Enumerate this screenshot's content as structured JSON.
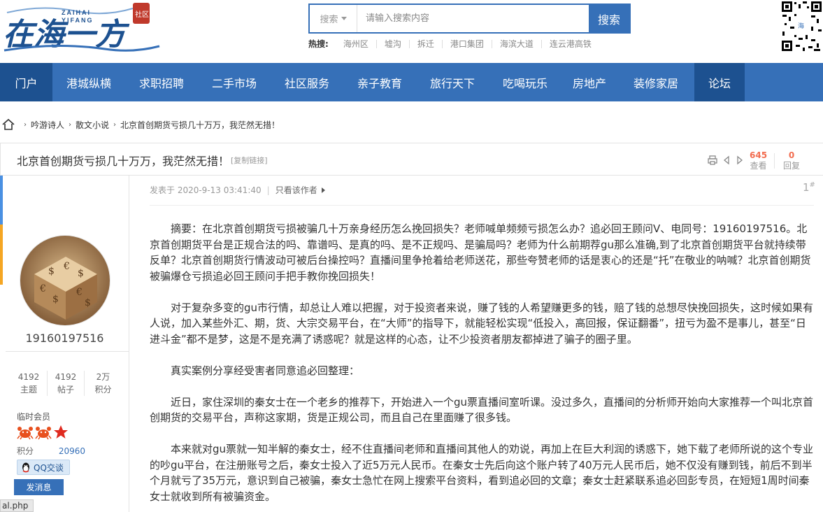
{
  "header": {
    "logo": {
      "main": "在海一方",
      "sub1": "ZAIHAI",
      "sub2": "YIFANG",
      "seal": "社区"
    },
    "search": {
      "type_label": "搜索",
      "placeholder": "请输入搜索内容",
      "button_label": "搜索"
    },
    "hot": {
      "label": "热搜:",
      "items": [
        "海州区",
        "墟沟",
        "拆迁",
        "港口集团",
        "海滨大道",
        "连云港高铁"
      ]
    }
  },
  "nav": {
    "items": [
      "门户",
      "港城纵横",
      "求职招聘",
      "二手市场",
      "社区服务",
      "亲子教育",
      "旅行天下",
      "吃喝玩乐",
      "房地产",
      "装修家居",
      "论坛"
    ]
  },
  "breadcrumb": {
    "items": [
      "吟游诗人",
      "散文小说",
      "北京首创期货亏损几十万万，我茫然无措！"
    ]
  },
  "thread": {
    "title": "北京首创期货亏损几十万万，我茫然无措！",
    "copy_link": "[复制链接]",
    "views": "645",
    "views_label": "查看",
    "replies": "0",
    "replies_label": "回复"
  },
  "author": {
    "username": "19160197516",
    "counts": [
      {
        "value": "4192",
        "label": "主题"
      },
      {
        "value": "4192",
        "label": "帖子"
      },
      {
        "value": "2万",
        "label": "积分"
      }
    ],
    "level": "临时会员",
    "points_label": "积分",
    "points_value": "20960",
    "qq_label": "QQ交谈",
    "message_label": "发消息"
  },
  "post": {
    "posted": "发表于 2020-9-13 03:41:40",
    "author_only": "只看该作者",
    "floor": "1",
    "floor_sup": "#",
    "paragraphs": [
      "摘要：在北京首创期货亏损被骗几十万亲身经历怎么挽回损失？老师喊单频频亏损怎么办？追必回王顾问V、电同号：19160197516。北京首创期货平台是正规合法的吗、靠谱吗、是真的吗、是不正规吗、是骗局吗？老师为什么前期荐gu那么准确,到了北京首创期货平台就持续带反单？北京首创期货行情波动可被后台操控吗？直播间里争抢着给老师送花，那些夸赞老师的话是衷心的还是“托”在敬业的呐喊？北京首创期货被骗爆仓亏损追必回王顾问手把手教你挽回损失！",
      "对于复杂多变的gu市行情，却总让人难以把握，对于投资者来说，赚了钱的人希望赚更多的钱，赔了钱的总想尽快挽回损失，这时候如果有人说，加入某些外汇、期，货、大宗交易平台，在“大师”的指导下，就能轻松实现“低投入，高回报，保证翻番”，扭亏为盈不是事儿，甚至“日进斗金”都不是梦，这是不是充满了诱惑呢？就是这样的心态，让不少投资者朋友都掉进了骗子的圈子里。",
      "真实案例分享经受害者同意追必回整理：",
      "近日，家住深圳的秦女士在一个老乡的推荐下，开始进入一个gu票直播间室听课。没过多久，直播间的分析师开始向大家推荐一个叫北京首创期货的交易平台，声称这家期，货是正规公司，而且自己在里面赚了很多钱。",
      "本来就对gu票就一知半解的秦女士，经不住直播间老师和直播间其他人的劝说，再加上在巨大利润的诱惑下，她下载了老师所说的这个专业的吵gu平台，在注册账号之后，秦女士投入了近5万元人民币。在秦女士先后向这个账户转了40万元人民币后，她不仅没有赚到钱，前后不到半个月就亏了35万元，意识到自己被骗，秦女士急忙在网上搜索平台资料，看到追必回的文章；秦女士赶紧联系追必回彭专员，在短短1周时间秦女士就收到所有被骗资金。"
    ]
  },
  "statusbar": {
    "text": "al.php"
  },
  "colors": {
    "brand": "#3670b8",
    "nav_dark": "#1d5190",
    "stat": "#f26c4f"
  }
}
